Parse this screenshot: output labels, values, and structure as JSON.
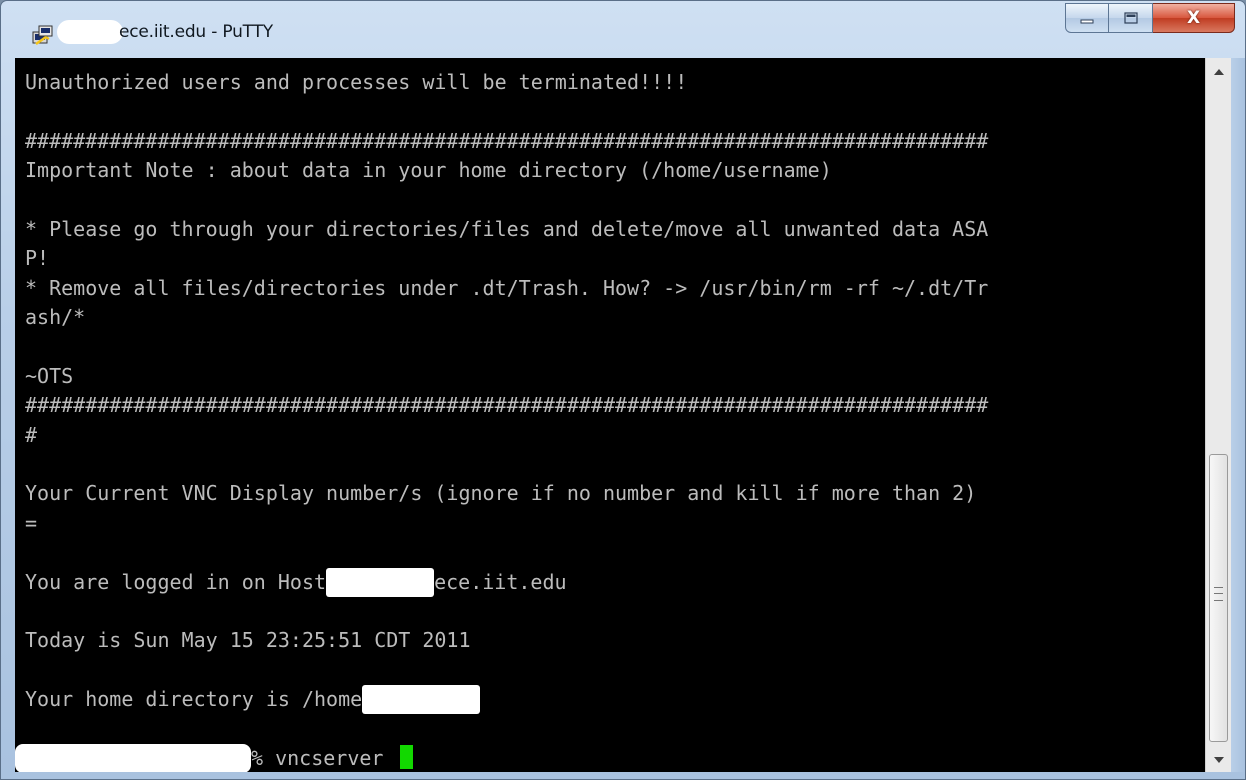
{
  "window": {
    "title": "ece.iit.edu - PuTTY",
    "icon": "putty-icon"
  },
  "caption_buttons": {
    "minimize_icon": "minimize-icon",
    "maximize_icon": "maximize-icon",
    "close_icon": "close-icon",
    "close_glyph": "X"
  },
  "terminal": {
    "colors": {
      "background": "#000000",
      "text": "#bcbcbc",
      "cursor": "#12d800"
    },
    "lines": {
      "l1": "Unauthorized users and processes will be terminated!!!!",
      "l2": "",
      "l3": "################################################################################",
      "l4": "Important Note : about data in your home directory (/home/username)",
      "l5": "",
      "l6": "* Please go through your directories/files and delete/move all unwanted data ASA",
      "l7": "P!",
      "l8": "* Remove all files/directories under .dt/Trash. How? -> /usr/bin/rm -rf ~/.dt/Tr",
      "l9": "ash/*",
      "l10": "",
      "l11": "~OTS",
      "l12": "################################################################################",
      "l13": "#",
      "l14": "",
      "l15": "Your Current VNC Display number/s (ignore if no number and kill if more than 2)",
      "l16": "=",
      "l17": "",
      "l18_prefix": "You are logged in on Host ",
      "l18_suffix": "ece.iit.edu",
      "l19": "",
      "l20": "Today is Sun May 15 23:25:51 CDT 2011",
      "l21": "",
      "l22_prefix": "Your home directory is /home/",
      "l23": "",
      "l24_prompt": "% vncserver "
    }
  }
}
